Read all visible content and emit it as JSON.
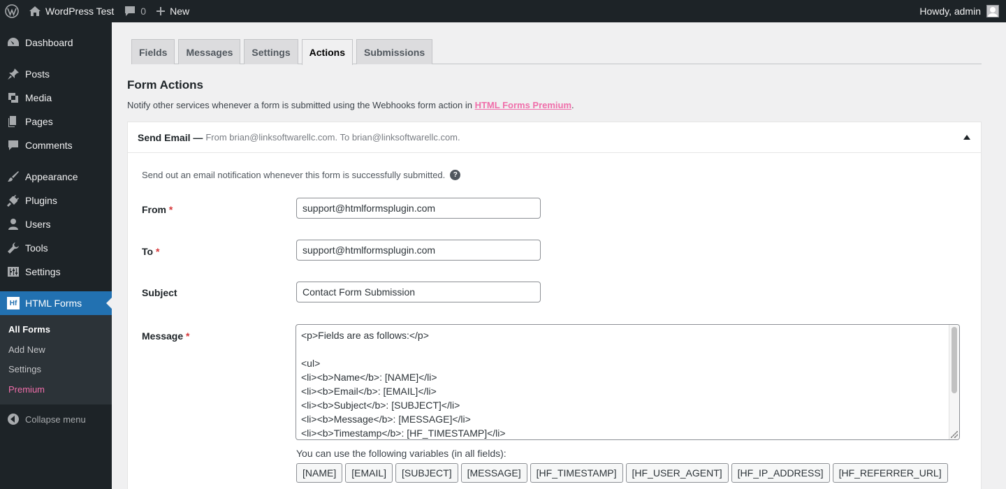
{
  "adminbar": {
    "site_name": "WordPress Test",
    "comments_count": "0",
    "new_label": "New",
    "greeting": "Howdy, admin"
  },
  "sidebar": {
    "items": [
      {
        "label": "Dashboard",
        "icon": "dashboard-icon"
      },
      {
        "label": "Posts",
        "icon": "pin-icon"
      },
      {
        "label": "Media",
        "icon": "media-icon"
      },
      {
        "label": "Pages",
        "icon": "pages-icon"
      },
      {
        "label": "Comments",
        "icon": "comment-icon"
      },
      {
        "label": "Appearance",
        "icon": "brush-icon"
      },
      {
        "label": "Plugins",
        "icon": "plug-icon"
      },
      {
        "label": "Users",
        "icon": "user-icon"
      },
      {
        "label": "Tools",
        "icon": "wrench-icon"
      },
      {
        "label": "Settings",
        "icon": "sliders-icon"
      }
    ],
    "active": {
      "label": "HTML Forms",
      "badge": "Hf"
    },
    "submenu": [
      "All Forms",
      "Add New",
      "Settings",
      "Premium"
    ],
    "collapse": "Collapse menu"
  },
  "tabs": [
    "Fields",
    "Messages",
    "Settings",
    "Actions",
    "Submissions"
  ],
  "active_tab": "Actions",
  "page": {
    "title": "Form Actions",
    "notice_prefix": "Notify other services whenever a form is submitted using the Webhooks form action in ",
    "notice_link": "HTML Forms Premium",
    "notice_suffix": "."
  },
  "panel": {
    "title": "Send Email —",
    "detail": "From brian@linksoftwarellc.com. To brian@linksoftwarellc.com.",
    "description": "Send out an email notification whenever this form is successfully submitted.",
    "help": "?",
    "from_label": "From",
    "from_value": "support@htmlformsplugin.com",
    "to_label": "To",
    "to_value": "support@htmlformsplugin.com",
    "subject_label": "Subject",
    "subject_value": "Contact Form Submission",
    "message_label": "Message",
    "required_mark": "*",
    "message_lines": [
      "<p>Fields are as follows:</p>",
      "",
      "<ul>",
      "<li><b>Name</b>: [NAME]</li>",
      "<li><b>Email</b>: [EMAIL]</li>",
      "<li><b>Subject</b>: [SUBJECT]</li>",
      "<li><b>Message</b>: [MESSAGE]</li>",
      "<li><b>Timestamp</b>: [HF_TIMESTAMP]</li>"
    ],
    "variables_label": "You can use the following variables (in all fields):",
    "variables": [
      "[NAME]",
      "[EMAIL]",
      "[SUBJECT]",
      "[MESSAGE]",
      "[HF_TIMESTAMP]",
      "[HF_USER_AGENT]",
      "[HF_IP_ADDRESS]",
      "[HF_REFERRER_URL]"
    ]
  }
}
